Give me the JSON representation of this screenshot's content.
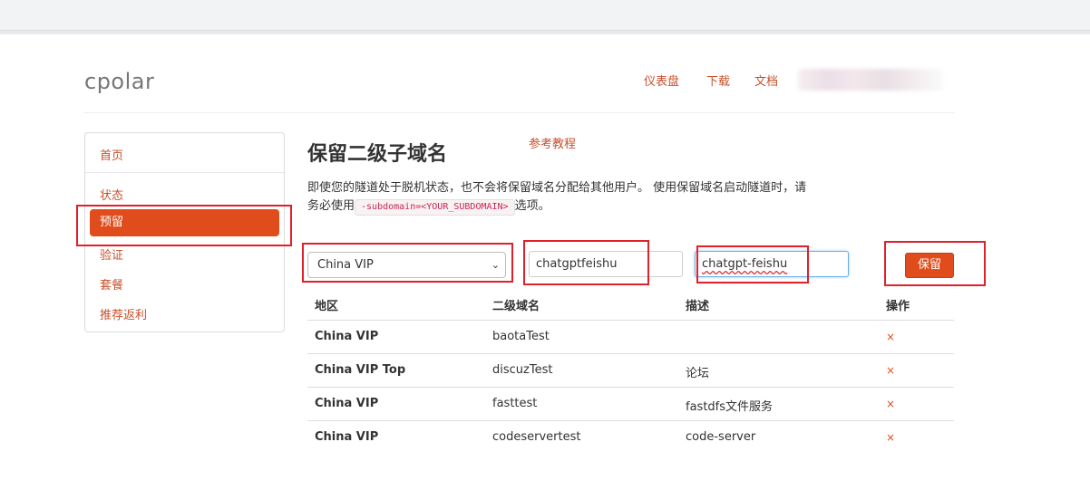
{
  "logo": "cpolar",
  "nav": {
    "dashboard": "仪表盘",
    "download": "下载",
    "docs": "文档"
  },
  "sidebar": {
    "items": [
      {
        "label": "首页"
      },
      {
        "label": "状态"
      },
      {
        "label": "预留",
        "active": true
      },
      {
        "label": "验证"
      },
      {
        "label": "套餐"
      },
      {
        "label": "推荐返利"
      }
    ]
  },
  "main": {
    "title": "保留二级子域名",
    "tutorial_link": "参考教程",
    "description_part1": "即使您的隧道处于脱机状态，也不会将保留域名分配给其他用户。 使用保留域名启动隧道时，请务必使用",
    "description_code": "-subdomain=<YOUR_SUBDOMAIN>",
    "description_part2": "选项。"
  },
  "form": {
    "region_selected": "China VIP",
    "subdomain_value": "chatgptfeishu",
    "description_value": "chatgpt-feishu",
    "save_label": "保留"
  },
  "table": {
    "headers": [
      "地区",
      "二级域名",
      "描述",
      "操作"
    ],
    "rows": [
      {
        "region": "China VIP",
        "subdomain": "baotaTest",
        "description": "",
        "action": "×"
      },
      {
        "region": "China VIP Top",
        "subdomain": "discuzTest",
        "description": "论坛",
        "action": "×"
      },
      {
        "region": "China VIP",
        "subdomain": "fasttest",
        "description": "fastdfs文件服务",
        "action": "×"
      },
      {
        "region": "China VIP",
        "subdomain": "codeservertest",
        "description": "code-server",
        "action": "×"
      }
    ]
  },
  "colors": {
    "accent": "#e04c1b",
    "link": "#c8502b",
    "highlight": "#e0202a"
  }
}
